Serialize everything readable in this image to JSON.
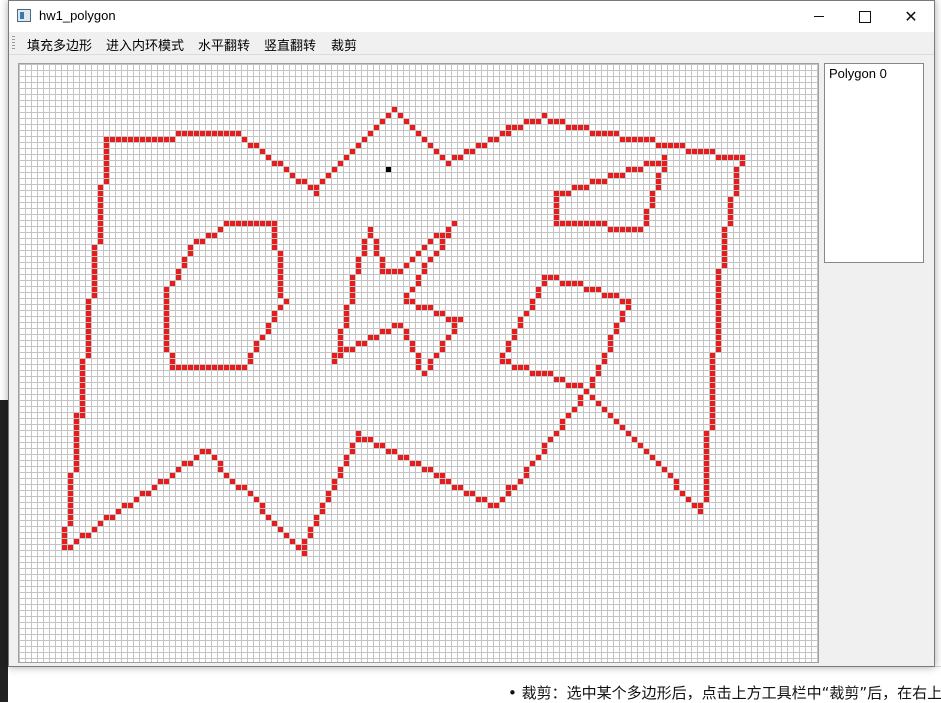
{
  "window": {
    "title": "hw1_polygon"
  },
  "menu": {
    "items": [
      {
        "label": "填充多边形"
      },
      {
        "label": "进入内环模式"
      },
      {
        "label": "水平翻转"
      },
      {
        "label": "竖直翻转"
      },
      {
        "label": "裁剪"
      }
    ]
  },
  "polygon_list": {
    "items": [
      {
        "label": "Polygon 0"
      }
    ]
  },
  "background": {
    "bottom_text": "• 裁剪：选中某个多边形后，点击上方工具栏中“裁剪”后，在右上的多"
  },
  "colors": {
    "outline": "#e81c1c",
    "marker": "#000000",
    "grid_line": "#c4c4c4",
    "window_bg": "#f0f0f0"
  },
  "icons": {
    "app": "window-app-icon",
    "minimize": "minimize-icon",
    "maximize": "maximize-icon",
    "close": "close-icon"
  }
}
